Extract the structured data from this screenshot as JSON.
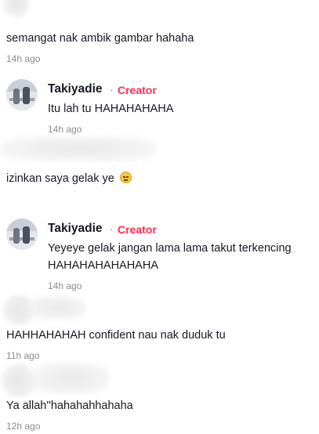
{
  "colors": {
    "creator_accent": "#fe2c55",
    "timestamp": "#8a8b91",
    "text": "#161823"
  },
  "comments": [
    {
      "text": "semangat nak ambik gambar hahaha",
      "time": "14h ago"
    },
    {
      "author": "Takiyadie",
      "separator": "·",
      "badge": "Creator",
      "text": "Itu lah tu HAHAHAHAHA",
      "time": "14h ago"
    },
    {
      "text": "izinkan saya gelak ye",
      "emoji": "pensive-face-emoji"
    },
    {
      "author": "Takiyadie",
      "separator": "·",
      "badge": "Creator",
      "text_line1": "Yeyeye gelak jangan lama lama takut terkencing",
      "text_line2": "HAHAHAHAHAHAHA",
      "time": "14h ago"
    },
    {
      "text": "HAHHAHAHAH confident nau nak duduk tu",
      "time": "11h ago"
    },
    {
      "text": "Ya allah''hahahahhahaha",
      "time": "12h ago"
    }
  ]
}
